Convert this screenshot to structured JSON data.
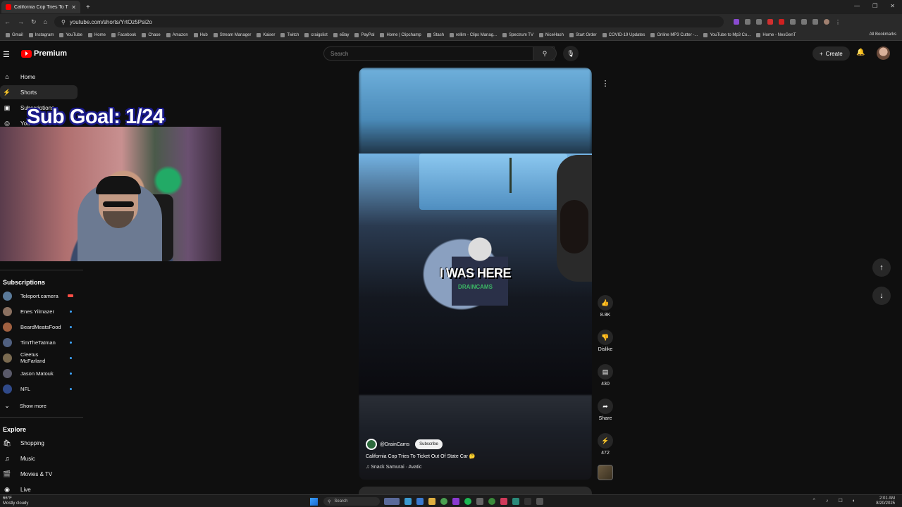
{
  "browser": {
    "tab_title": "California Cop Tries To Tick",
    "url": "youtube.com/shorts/YrtOz5Psi2o",
    "bookmarks": [
      "Gmail",
      "Instagram",
      "YouTube",
      "Home",
      "Facebook",
      "Chase",
      "Amazon",
      "Hub",
      "Stream Manager",
      "Kaiser",
      "Twitch",
      "craigslist",
      "eBay",
      "PayPal",
      "Home | Clipchamp",
      "Stash",
      "rellim - Clips Manag...",
      "Spectrum TV",
      "NiceHash",
      "Start Order",
      "COVID-19 Updates",
      "Online MP3 Cutter -...",
      "YouTube to Mp3 Co...",
      "Home - NexGenT"
    ],
    "all_bookmarks": "All Bookmarks"
  },
  "header": {
    "logo_text": "Premium",
    "search_placeholder": "Search",
    "create_label": "Create"
  },
  "sidebar": {
    "items": [
      {
        "label": "Home",
        "icon": "home-icon"
      },
      {
        "label": "Shorts",
        "icon": "shorts-icon"
      },
      {
        "label": "Subscriptions",
        "icon": "subscriptions-icon"
      },
      {
        "label": "You",
        "icon": "you-icon"
      }
    ],
    "subscriptions_heading": "Subscriptions",
    "subscriptions": [
      {
        "name": "Teleport.camera",
        "badge": "live"
      },
      {
        "name": "Enes Yilmazer",
        "badge": "dot"
      },
      {
        "name": "BeardMeatsFood",
        "badge": "dot"
      },
      {
        "name": "TimTheTatman",
        "badge": "dot"
      },
      {
        "name": "Cleetus McFarland",
        "badge": "dot"
      },
      {
        "name": "Jason Matouk",
        "badge": "dot"
      },
      {
        "name": "NFL",
        "badge": "dot"
      }
    ],
    "show_more": "Show more",
    "explore_heading": "Explore",
    "explore": [
      {
        "label": "Shopping",
        "icon": "shopping-bag-icon"
      },
      {
        "label": "Music",
        "icon": "music-note-icon"
      },
      {
        "label": "Movies & TV",
        "icon": "clapperboard-icon"
      },
      {
        "label": "Live",
        "icon": "live-icon"
      }
    ]
  },
  "overlay": {
    "sub_goal": "Sub Goal: 1/24"
  },
  "short": {
    "caption": "I WAS HERE",
    "watermark": "DRAINCAMS",
    "channel": "@DrainCams",
    "subscribe_label": "Subscribe",
    "title": "California Cop Tries To Ticket Out Of State Car 🤔",
    "music": "♫ Snack Samurai · Avatic",
    "actions": [
      {
        "name": "like",
        "label": "8.8K",
        "icon": "thumbs-up-icon"
      },
      {
        "name": "dislike",
        "label": "Dislike",
        "icon": "thumbs-down-icon"
      },
      {
        "name": "comments",
        "label": "430",
        "icon": "comment-icon"
      },
      {
        "name": "share",
        "label": "Share",
        "icon": "share-icon"
      },
      {
        "name": "remix",
        "label": "472",
        "icon": "remix-icon"
      }
    ]
  },
  "taskbar": {
    "weather_temp": "66°F",
    "weather_desc": "Mostly cloudy",
    "search_label": "Search",
    "time": "2:01 AM",
    "date": "8/20/2025"
  },
  "colors": {
    "brand": "#ff0000",
    "background": "#0f0f0f",
    "overlay_outline": "#1a1a8a",
    "watermark": "#3fcf6a"
  }
}
